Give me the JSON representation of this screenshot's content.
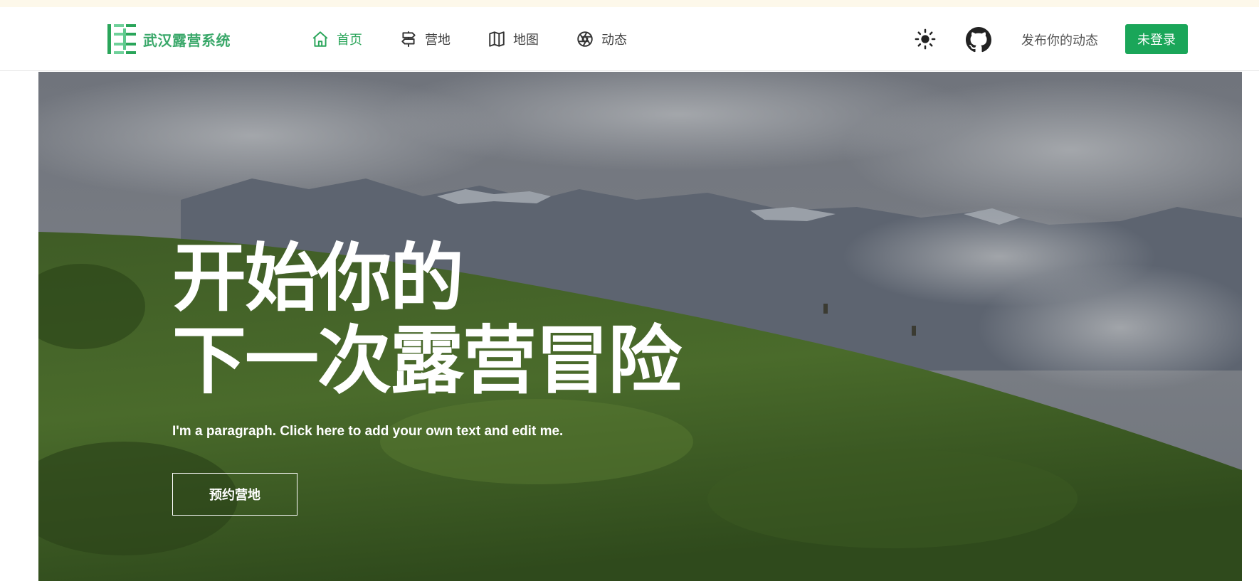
{
  "brand": {
    "name": "武汉露营系统"
  },
  "nav": {
    "items": [
      {
        "label": "首页",
        "icon": "home-icon",
        "active": true
      },
      {
        "label": "营地",
        "icon": "signpost-icon",
        "active": false
      },
      {
        "label": "地图",
        "icon": "map-icon",
        "active": false
      },
      {
        "label": "动态",
        "icon": "aperture-icon",
        "active": false
      }
    ]
  },
  "toolbar": {
    "theme_icon": "sun-icon",
    "github_icon": "github-icon",
    "post_label": "发布你的动态",
    "login_label": "未登录"
  },
  "hero": {
    "title_line1": "开始你的",
    "title_line2": "下一次露营冒险",
    "subtitle": "I'm a paragraph. Click here to add your own text and edit me.",
    "cta_label": "预约营地"
  },
  "colors": {
    "accent": "#1aa659",
    "active_nav": "#2aa55a",
    "brand_text": "#3aa86a",
    "top_strip": "#fdf8ea"
  }
}
